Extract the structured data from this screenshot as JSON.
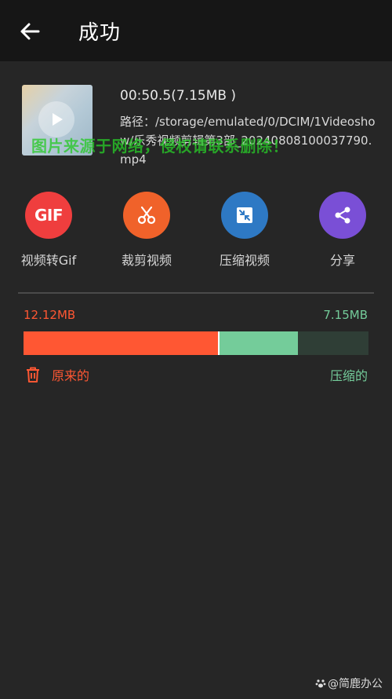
{
  "header": {
    "title": "成功"
  },
  "video": {
    "duration_size": "00:50.5(7.15MB )",
    "path": "路径：/storage/emulated/0/DCIM/1Videoshow/乐秀视频剪辑第3部_20240808100037790.mp4"
  },
  "watermark": "图片来源于网络，侵权请联系删除！",
  "actions": [
    {
      "label": "视频转Gif",
      "icon": "gif-icon",
      "color": "#EF3E3E",
      "icon_text": "GIF"
    },
    {
      "label": "裁剪视频",
      "icon": "scissors-icon",
      "color": "#F0622A"
    },
    {
      "label": "压缩视频",
      "icon": "compress-icon",
      "color": "#2E79C4"
    },
    {
      "label": "分享",
      "icon": "share-icon",
      "color": "#7A4FD6"
    }
  ],
  "compression": {
    "original_size": "12.12MB",
    "compressed_size": "7.15MB",
    "original_label": "原来的",
    "compressed_label": "压缩的",
    "compressed_fraction": 0.59,
    "original_fraction": 1.0,
    "original_color": "#FF5733",
    "compressed_color": "#74CC9A",
    "track_color": "#2F3E36"
  },
  "credit": "@简鹿办公"
}
